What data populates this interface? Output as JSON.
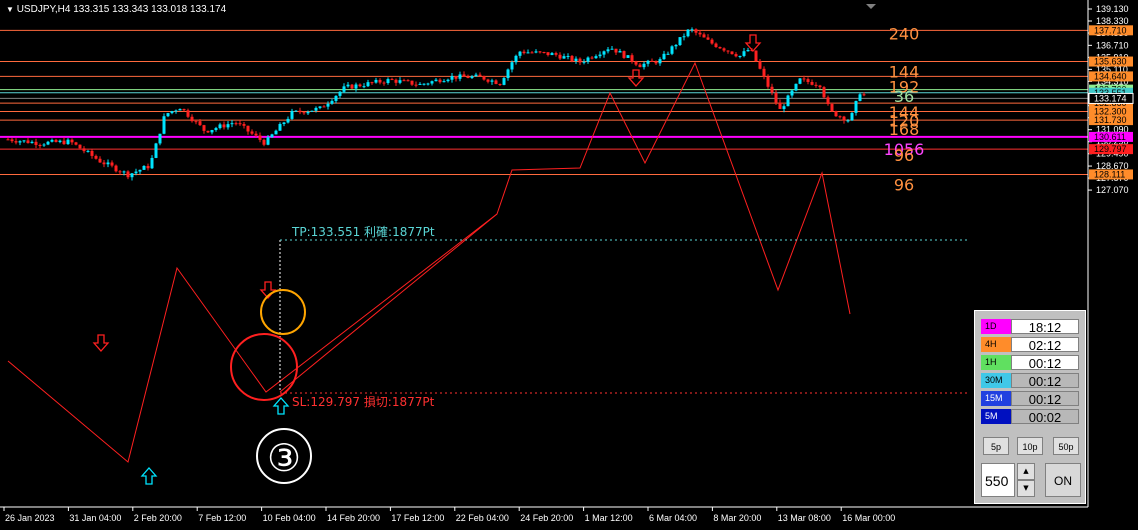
{
  "header": {
    "menu_marker": "▼",
    "symbol": "USDJPY,H4",
    "ohlc": "133.315 133.343 133.018 133.174"
  },
  "price_axis": {
    "ticks": [
      "139.130",
      "138.330",
      "137.530",
      "136.710",
      "135.910",
      "135.110",
      "134.310",
      "133.174",
      "132.690",
      "131.890",
      "131.090",
      "130.290",
      "129.490",
      "128.670",
      "127.870",
      "127.070"
    ]
  },
  "time_axis": {
    "ticks": [
      "26 Jan 2023",
      "31 Jan 04:00",
      "2 Feb 20:00",
      "7 Feb 12:00",
      "10 Feb 04:00",
      "14 Feb 20:00",
      "17 Feb 12:00",
      "22 Feb 04:00",
      "24 Feb 20:00",
      "1 Mar 12:00",
      "6 Mar 04:00",
      "8 Mar 20:00",
      "13 Mar 08:00",
      "16 Mar 00:00"
    ]
  },
  "levels": [
    {
      "price": "137.710",
      "label": "240",
      "line": "#ff6a3d",
      "tag_bg": "#ff8c2a",
      "text": "#ff9040"
    },
    {
      "price": "135.630",
      "label": "144",
      "line": "#ff6a3d",
      "tag_bg": "#ff8c2a",
      "text": "#ff9040"
    },
    {
      "price": "134.640",
      "label": "192",
      "line": "#ff6a3d",
      "tag_bg": "#ff8c2a",
      "text": "#ff9040"
    },
    {
      "price": "133.760",
      "label": "",
      "line": "#90ee90",
      "tag_bg": "#90ee90",
      "text": "#90ee90"
    },
    {
      "price": "133.551",
      "label": "36",
      "line": "#5ad6d6",
      "tag_bg": "#40c8c8",
      "text": "#a0e0a0"
    },
    {
      "price": "132.860",
      "label": "144",
      "line": "#ff6a3d",
      "tag_bg": "#ff8c2a",
      "text": "#ff9040"
    },
    {
      "price": "132.300",
      "label": "120",
      "line": "#ff6a3d",
      "tag_bg": "#ff8c2a",
      "text": "#ff9040"
    },
    {
      "price": "131.730",
      "label": "168",
      "line": "#ff6a3d",
      "tag_bg": "#ff8c2a",
      "text": "#ff9040"
    },
    {
      "price": "130.611",
      "label": "1056",
      "line": "#ff00ff",
      "tag_bg": "#ff00ff",
      "text": "#ff44ff"
    },
    {
      "price": "129.797",
      "label": "96",
      "line": "#ff3030",
      "tag_bg": "#ff2020",
      "text": "#ff9040"
    },
    {
      "price": "128.111",
      "label": "96",
      "line": "#ff6a3d",
      "tag_bg": "#ff8c2a",
      "text": "#ff9040"
    }
  ],
  "current_price_tag": "133.174",
  "trade": {
    "tp_text": "TP:133.551 利確:1877Pt",
    "sl_text": "SL:129.797 損切:1877Pt",
    "tp_color": "#5ad6d6",
    "sl_color": "#ff3030"
  },
  "annotation": {
    "circled_number": "③"
  },
  "timeframe_panel": {
    "rows": [
      {
        "label": "1D",
        "time": "18:12",
        "label_bg": "#ff00ff",
        "value_bg": "#ffffff"
      },
      {
        "label": "4H",
        "time": "02:12",
        "label_bg": "#ff8c2a",
        "value_bg": "#ffffff"
      },
      {
        "label": "1H",
        "time": "00:12",
        "label_bg": "#60e060",
        "value_bg": "#ffffff"
      },
      {
        "label": "30M",
        "time": "00:12",
        "label_bg": "#40c8e8",
        "value_bg": "#b8b8b8"
      },
      {
        "label": "15M",
        "time": "00:12",
        "label_bg": "#2040e0",
        "value_bg": "#b8b8b8"
      },
      {
        "label": "5M",
        "time": "00:02",
        "label_bg": "#0010c0",
        "value_bg": "#b8b8b8"
      }
    ],
    "buttons": [
      "5p",
      "10p",
      "50p"
    ],
    "input_value": "550",
    "spin_up": "▲",
    "spin_down": "▼",
    "on_label": "ON"
  },
  "colors": {
    "bull": "#00e5ff",
    "bear": "#ff2020",
    "wave": "#ff2020",
    "up_arrow": "#00e5ff",
    "down_arrow": "#ff2020",
    "orange_circle": "#ffa500",
    "red_circle": "#ff2020"
  }
}
